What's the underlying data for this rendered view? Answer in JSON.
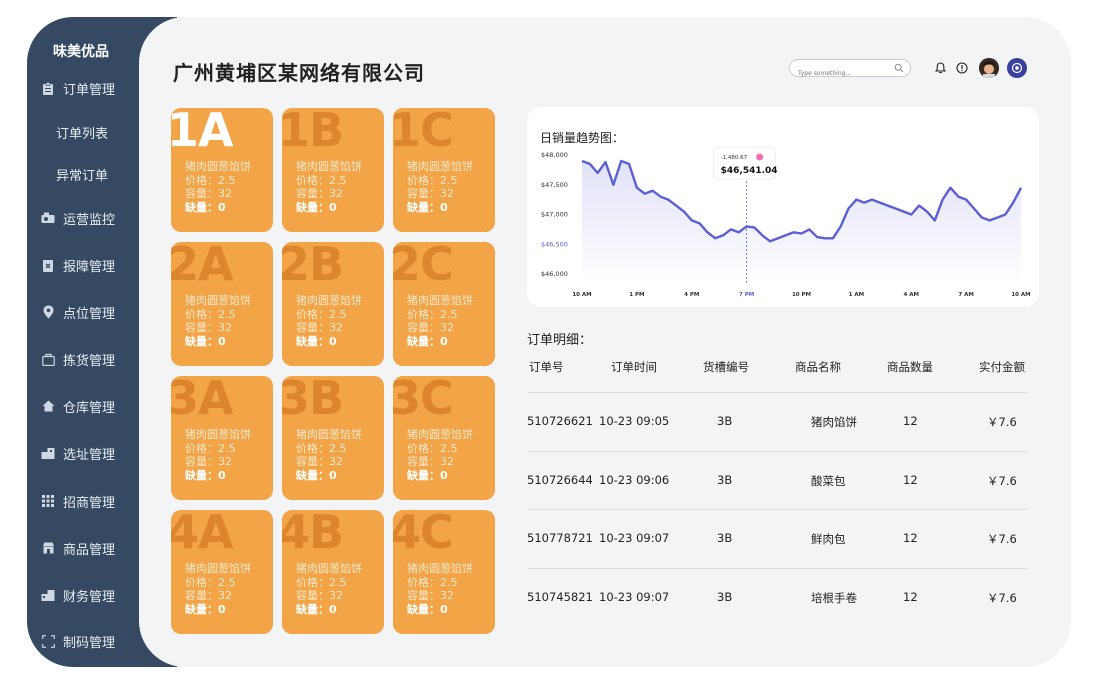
{
  "brand": "味美优品",
  "sidebar": {
    "items": [
      {
        "label": "订单管理",
        "icon": "clipboard-icon"
      },
      {
        "label": "订单列表",
        "sub": true
      },
      {
        "label": "异常订单",
        "sub": true
      },
      {
        "label": "运营监控",
        "icon": "monitor-icon"
      },
      {
        "label": "报障管理",
        "icon": "report-icon"
      },
      {
        "label": "点位管理",
        "icon": "location-icon"
      },
      {
        "label": "拣货管理",
        "icon": "bag-icon"
      },
      {
        "label": "仓库管理",
        "icon": "home-icon"
      },
      {
        "label": "选址管理",
        "icon": "building-icon"
      },
      {
        "label": "招商管理",
        "icon": "grid-icon"
      },
      {
        "label": "商品管理",
        "icon": "shop-icon"
      },
      {
        "label": "财务管理",
        "icon": "finance-icon"
      },
      {
        "label": "制码管理",
        "icon": "scan-icon"
      }
    ]
  },
  "header": {
    "title": "广州黄埔区某网络有限公司",
    "search_placeholder": "Type something..."
  },
  "slots": [
    {
      "code": "1A",
      "name": "猪肉圆葱馅饼",
      "price": "价格：2.5",
      "capacity": "容量：32",
      "shortage": "缺量：0"
    },
    {
      "code": "1B",
      "name": "猪肉圆葱馅饼",
      "price": "价格：2.5",
      "capacity": "容量：32",
      "shortage": "缺量：0"
    },
    {
      "code": "1C",
      "name": "猪肉圆葱馅饼",
      "price": "价格：2.5",
      "capacity": "容量：32",
      "shortage": "缺量：0"
    },
    {
      "code": "2A",
      "name": "猪肉圆葱馅饼",
      "price": "价格：2.5",
      "capacity": "容量：32",
      "shortage": "缺量：0"
    },
    {
      "code": "2B",
      "name": "猪肉圆葱馅饼",
      "price": "价格：2.5",
      "capacity": "容量：32",
      "shortage": "缺量：0"
    },
    {
      "code": "2C",
      "name": "猪肉圆葱馅饼",
      "price": "价格：2.5",
      "capacity": "容量：32",
      "shortage": "缺量：0"
    },
    {
      "code": "3A",
      "name": "猪肉圆葱馅饼",
      "price": "价格：2.5",
      "capacity": "容量：32",
      "shortage": "缺量：0"
    },
    {
      "code": "3B",
      "name": "猪肉圆葱馅饼",
      "price": "价格：2.5",
      "capacity": "容量：32",
      "shortage": "缺量：0"
    },
    {
      "code": "3C",
      "name": "猪肉圆葱馅饼",
      "price": "价格：2.5",
      "capacity": "容量：32",
      "shortage": "缺量：0"
    },
    {
      "code": "4A",
      "name": "猪肉圆葱馅饼",
      "price": "价格：2.5",
      "capacity": "容量：32",
      "shortage": "缺量：0"
    },
    {
      "code": "4B",
      "name": "猪肉圆葱馅饼",
      "price": "价格：2.5",
      "capacity": "容量：32",
      "shortage": "缺量：0"
    },
    {
      "code": "4C",
      "name": "猪肉圆葱馅饼",
      "price": "价格：2.5",
      "capacity": "容量：32",
      "shortage": "缺量：0"
    }
  ],
  "chart_data": {
    "type": "line",
    "title": "日销量趋势图：",
    "y_ticks": [
      "$48,000",
      "$47,500",
      "$47,000",
      "$46,500",
      "$46,000"
    ],
    "highlight_tick": "$46,500",
    "x_ticks": [
      "10 AM",
      "1 PM",
      "4 PM",
      "7 PM",
      "10 PM",
      "1 AM",
      "4 AM",
      "7 AM",
      "10 AM"
    ],
    "highlight_x": "7 PM",
    "ylim": [
      46000,
      48000
    ],
    "tooltip": {
      "delta": "-1,480.67",
      "value": "$46,541.04"
    },
    "series_color": "#5b5fd6",
    "values": [
      47900,
      47850,
      47700,
      47880,
      47500,
      47900,
      47850,
      47450,
      47350,
      47400,
      47300,
      47250,
      47150,
      47050,
      46900,
      46850,
      46700,
      46600,
      46650,
      46750,
      46700,
      46800,
      46780,
      46650,
      46550,
      46600,
      46650,
      46700,
      46680,
      46750,
      46620,
      46600,
      46600,
      46800,
      47100,
      47250,
      47200,
      47250,
      47200,
      47150,
      47100,
      47050,
      47000,
      47150,
      47050,
      46900,
      47250,
      47450,
      47300,
      47250,
      47100,
      46950,
      46900,
      46950,
      47000,
      47200,
      47450
    ]
  },
  "orders": {
    "title": "订单明细：",
    "columns": [
      "订单号",
      "订单时间",
      "货槽编号",
      "商品名称",
      "商品数量",
      "实付金额"
    ],
    "rows": [
      [
        "510726621",
        "10-23 09:05",
        "3B",
        "猪肉馅饼",
        "12",
        "￥7.6"
      ],
      [
        "510726644",
        "10-23 09:06",
        "3B",
        "酸菜包",
        "12",
        "￥7.6"
      ],
      [
        "510778721",
        "10-23 09:07",
        "3B",
        "鲜肉包",
        "12",
        "￥7.6"
      ],
      [
        "510745821",
        "10-23 09:07",
        "3B",
        "培根手卷",
        "12",
        "￥7.6"
      ]
    ]
  },
  "colors": {
    "sidebar": "#354a62",
    "slot": "#f2a446",
    "accent": "#5b5fd6"
  }
}
